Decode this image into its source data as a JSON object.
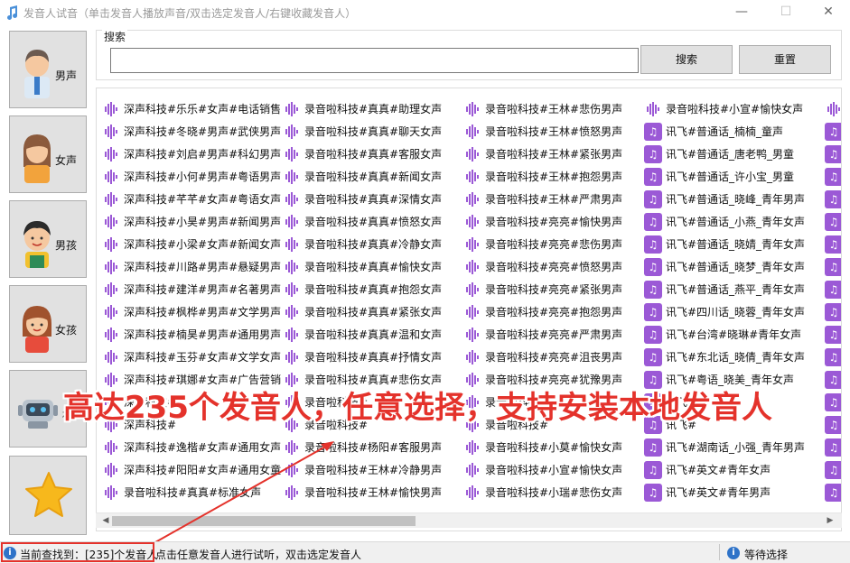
{
  "window": {
    "title": "发音人试音（单击发音人播放声音/双击选定发音人/右键收藏发音人）",
    "minimize_glyph": "—",
    "maximize_glyph": "☐",
    "close_glyph": "✕"
  },
  "sidebar": {
    "items": [
      {
        "label": "男声",
        "icon": "male-avatar-icon"
      },
      {
        "label": "女声",
        "icon": "female-avatar-icon"
      },
      {
        "label": "男孩",
        "icon": "boy-avatar-icon"
      },
      {
        "label": "女孩",
        "icon": "girl-avatar-icon"
      },
      {
        "label": "机",
        "icon": "robot-icon"
      },
      {
        "label": "",
        "icon": "star-icon"
      }
    ]
  },
  "search": {
    "group_label": "搜索",
    "input_value": "",
    "search_button": "搜索",
    "reset_button": "重置"
  },
  "voice_list": {
    "columns": [
      [
        "深声科技#乐乐#女声#电话销售",
        "深声科技#冬晓#男声#武侠男声",
        "深声科技#刘启#男声#科幻男声",
        "深声科技#小何#男声#粤语男声",
        "深声科技#芊芊#女声#粤语女声",
        "深声科技#小昊#男声#新闻男声",
        "深声科技#小梁#女声#新闻女声",
        "深声科技#川路#男声#悬疑男声",
        "深声科技#建洋#男声#名著男声",
        "深声科技#枫桦#男声#文学男声",
        "深声科技#楠昊#男声#通用男声",
        "深声科技#玉芬#女声#文学女声",
        "深声科技#琪娜#女声#广告营销",
        "深声科技#",
        "深声科技#",
        "深声科技#逸楷#女声#通用女声",
        "深声科技#阳阳#女声#通用女童",
        "录音啦科技#真真#标准女声"
      ],
      [
        "录音啦科技#真真#助理女声",
        "录音啦科技#真真#聊天女声",
        "录音啦科技#真真#客服女声",
        "录音啦科技#真真#新闻女声",
        "录音啦科技#真真#深情女声",
        "录音啦科技#真真#愤怒女声",
        "录音啦科技#真真#冷静女声",
        "录音啦科技#真真#愉快女声",
        "录音啦科技#真真#抱怨女声",
        "录音啦科技#真真#紧张女声",
        "录音啦科技#真真#温和女声",
        "录音啦科技#真真#抒情女声",
        "录音啦科技#真真#悲伤女声",
        "录音啦科技#",
        "录音啦科技#",
        "录音啦科技#杨阳#客服男声",
        "录音啦科技#王林#冷静男声",
        "录音啦科技#王林#愉快男声"
      ],
      [
        "录音啦科技#王林#悲伤男声",
        "录音啦科技#王林#愤怒男声",
        "录音啦科技#王林#紧张男声",
        "录音啦科技#王林#抱怨男声",
        "录音啦科技#王林#严肃男声",
        "录音啦科技#亮亮#愉快男声",
        "录音啦科技#亮亮#悲伤男声",
        "录音啦科技#亮亮#愤怒男声",
        "录音啦科技#亮亮#紧张男声",
        "录音啦科技#亮亮#抱怨男声",
        "录音啦科技#亮亮#严肃男声",
        "录音啦科技#亮亮#沮丧男声",
        "录音啦科技#亮亮#犹豫男声",
        "录音啦科技#",
        "录音啦科技#",
        "录音啦科技#小莫#愉快女声",
        "录音啦科技#小宣#愉快女声",
        "录音啦科技#小瑞#悲伤女声"
      ],
      [
        "录音啦科技#小宣#愉快女声",
        "讯飞#普通话_楠楠_童声",
        "讯飞#普通话_唐老鸭_男童",
        "讯飞#普通话_许小宝_男童",
        "讯飞#普通话_晓峰_青年男声",
        "讯飞#普通话_小燕_青年女声",
        "讯飞#普通话_晓婧_青年女声",
        "讯飞#普通话_晓梦_青年女声",
        "讯飞#普通话_燕平_青年女声",
        "讯飞#四川话_晓蓉_青年女声",
        "讯飞#台湾#晓琳#青年女声",
        "讯飞#东北话_晓倩_青年女声",
        "讯飞#粤语_晓美_青年女声",
        "讯飞#",
        "讯飞#",
        "讯飞#湖南话_小强_青年男声",
        "讯飞#英文#青年女声",
        "讯飞#英文#青年男声"
      ]
    ],
    "column_icons": [
      "wave",
      "wave",
      "wave",
      "wave-then-note"
    ]
  },
  "banner": {
    "text": "高达235个发音人，任意选择，支持安装本地发音人"
  },
  "status": {
    "found_text": "当前查找到：[235]个发音人",
    "hint_text": "点击任意发音人进行试听，双击选定发音人",
    "state_text": "等待选择"
  },
  "colors": {
    "wave_icon": "#9b59d6",
    "note_icon_bg": "#9b59d6",
    "annotation": "#e4322b",
    "info_icon": "#2f73c8"
  }
}
